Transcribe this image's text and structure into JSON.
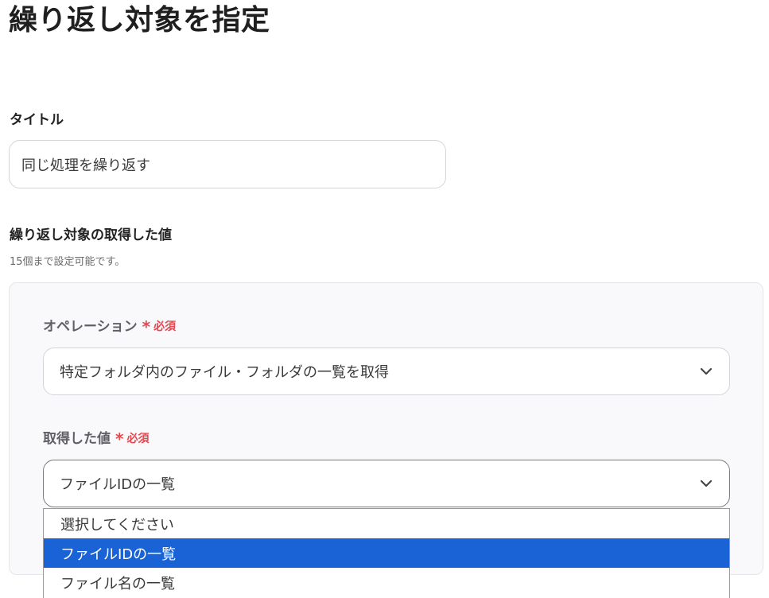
{
  "page": {
    "title": "繰り返し対象を指定"
  },
  "title_field": {
    "label": "タイトル",
    "value": "同じ処理を繰り返す"
  },
  "target": {
    "label": "繰り返し対象の取得した値",
    "hint": "15個まで設定可能です。",
    "operation": {
      "label": "オペレーション",
      "required_mark": "*",
      "required_text": "必須",
      "value": "特定フォルダ内のファイル・フォルダの一覧を取得"
    },
    "value": {
      "label": "取得した値",
      "required_mark": "*",
      "required_text": "必須",
      "selected": "ファイルIDの一覧"
    },
    "options": [
      "選択してください",
      "ファイルIDの一覧",
      "ファイル名の一覧"
    ]
  },
  "icons": {
    "select_chevron": "chevron-down-icon"
  },
  "colors": {
    "required": "#e5484d",
    "selected_option_bg": "#1a63d6"
  }
}
